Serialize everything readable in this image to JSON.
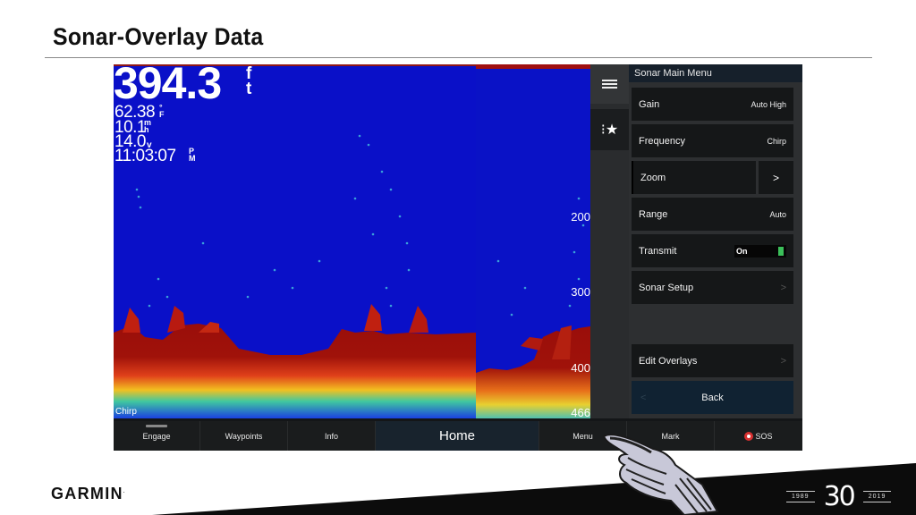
{
  "slide": {
    "title": "Sonar-Overlay Data",
    "brand": "GARMIN",
    "anniversary": {
      "start_year": "1989",
      "number": "30",
      "end_year": "2019"
    }
  },
  "sonar": {
    "depth_value": "394.3",
    "depth_unit_top": "f",
    "depth_unit_bottom": "t",
    "water_temp": "62.38",
    "water_temp_unit_top": "°",
    "water_temp_unit_bottom": "F",
    "speed": "10.1",
    "speed_unit_top": "m",
    "speed_unit_bottom": "h",
    "voltage": "14.0",
    "voltage_unit": "v",
    "time": "11:03:07",
    "time_unit_top": "P",
    "time_unit_bottom": "M",
    "frequency_label": "Chirp",
    "depth_scale": [
      "200",
      "300",
      "400",
      "466"
    ],
    "colors": {
      "water": "#0a10c8",
      "bottom": "#9a0e0a"
    }
  },
  "side_icons": [
    {
      "name": "menu"
    },
    {
      "name": "favorites"
    }
  ],
  "menu": {
    "title": "Sonar Main Menu",
    "items": [
      {
        "label": "Gain",
        "value": "Auto High"
      },
      {
        "label": "Frequency",
        "value": "Chirp"
      },
      {
        "label": "Zoom",
        "value": ">"
      },
      {
        "label": "Range",
        "value": "Auto"
      },
      {
        "label": "Transmit",
        "value": "On"
      },
      {
        "label": "Sonar Setup",
        "value": ">"
      },
      {
        "label": "Edit Overlays",
        "value": ">"
      },
      {
        "label": "Back",
        "value": "<"
      }
    ],
    "toggle_color": "#3bbf5a"
  },
  "bottom_bar": {
    "buttons": [
      "Engage",
      "Waypoints",
      "Info",
      "Home",
      "Menu",
      "Mark",
      "SOS"
    ]
  }
}
